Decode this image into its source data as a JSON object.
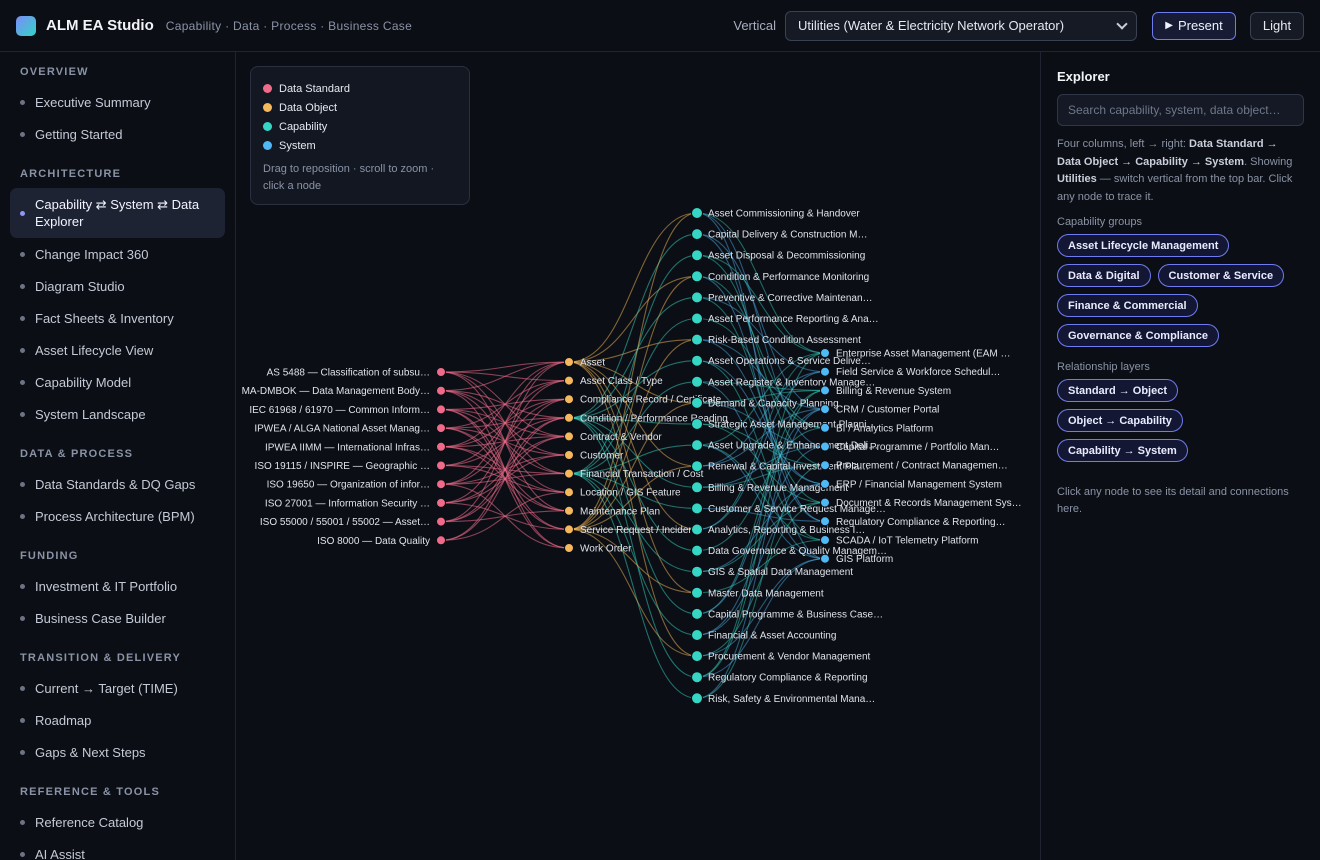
{
  "app": {
    "title": "ALM EA Studio",
    "subtitle": "Capability · Data · Process · Business Case",
    "vertical_label": "Vertical",
    "vertical_value": "Utilities (Water & Electricity Network Operator)",
    "present_label": "Present",
    "theme_label": "Light"
  },
  "sidebar": [
    {
      "section": "OVERVIEW",
      "items": [
        "Executive Summary",
        "Getting Started"
      ]
    },
    {
      "section": "ARCHITECTURE",
      "items": [
        "Capability ⇄ System ⇄ Data Explorer",
        "Change Impact 360",
        "Diagram Studio",
        "Fact Sheets & Inventory",
        "Asset Lifecycle View",
        "Capability Model",
        "System Landscape"
      ]
    },
    {
      "section": "DATA & PROCESS",
      "items": [
        "Data Standards & DQ Gaps",
        "Process Architecture (BPM)"
      ]
    },
    {
      "section": "FUNDING",
      "items": [
        "Investment & IT Portfolio",
        "Business Case Builder"
      ]
    },
    {
      "section": "TRANSITION & DELIVERY",
      "items": [
        "Current → Target (TIME)",
        "Roadmap",
        "Gaps & Next Steps"
      ]
    },
    {
      "section": "REFERENCE & TOOLS",
      "items": [
        "Reference Catalog",
        "AI Assist"
      ]
    }
  ],
  "active_nav": "Capability ⇄ System ⇄ Data Explorer",
  "legend": {
    "items": [
      {
        "label": "Data Standard",
        "color": "#f06b8a"
      },
      {
        "label": "Data Object",
        "color": "#f5b95c"
      },
      {
        "label": "Capability",
        "color": "#35d6c4"
      },
      {
        "label": "System",
        "color": "#4fb9f5"
      }
    ],
    "hint": "Drag to reposition · scroll to zoom · click a node"
  },
  "graph": {
    "standards": [
      "AS 5488 — Classification of subsu…",
      "MA-DMBOK — Data Management Body…",
      "IEC 61968 / 61970 — Common Inform…",
      "IPWEA / ALGA National Asset Manag…",
      "IPWEA IIMM — International Infras…",
      "ISO 19115 / INSPIRE — Geographic …",
      "ISO 19650 — Organization of infor…",
      "ISO 27001 — Information Security …",
      "ISO 55000 / 55001 / 55002 — Asset…",
      "ISO 8000 — Data Quality"
    ],
    "objects": [
      "Asset",
      "Asset Class / Type",
      "Compliance Record / Certificate",
      "Condition / Performance Reading",
      "Contract & Vendor",
      "Customer",
      "Financial Transaction / Cost",
      "Location / GIS Feature",
      "Maintenance Plan",
      "Service Request / Incident",
      "Work Order"
    ],
    "capabilities": [
      "Asset Commissioning & Handover",
      "Capital Delivery & Construction M…",
      "Asset Disposal & Decommissioning",
      "Condition & Performance Monitoring",
      "Preventive & Corrective Maintenan…",
      "Asset Performance Reporting & Ana…",
      "Risk-Based Condition Assessment",
      "Asset Operations & Service Delive…",
      "Asset Register & Inventory Manage…",
      "Demand & Capacity Planning",
      "Strategic Asset Management Planni…",
      "Asset Upgrade & Enhancement Deli…",
      "Renewal & Capital Investment Pla…",
      "Billing & Revenue Management",
      "Customer & Service Request Manage…",
      "Analytics, Reporting & Business I…",
      "Data Governance & Quality Managem…",
      "GIS & Spatial Data Management",
      "Master Data Management",
      "Capital Programme & Business Case…",
      "Financial & Asset Accounting",
      "Procurement & Vendor Management",
      "Regulatory Compliance & Reporting",
      "Risk, Safety & Environmental Mana…"
    ],
    "systems": [
      "Enterprise Asset Management (EAM …",
      "Field Service & Workforce Schedul…",
      "Billing & Revenue System",
      "CRM / Customer Portal",
      "BI / Analytics Platform",
      "Capital Programme / Portfolio Man…",
      "Procurement / Contract Managemen…",
      "ERP / Financial Management System",
      "Document & Records Management Sys…",
      "Regulatory Compliance & Reporting…",
      "SCADA / IoT Telemetry Platform",
      "GIS Platform"
    ]
  },
  "explorer": {
    "title": "Explorer",
    "search_placeholder": "Search capability, system, data object…",
    "desc_1": "Four columns, left → right: ",
    "desc_flow": "Data Standard → Data Object → Capability → System",
    "desc_2": ". Showing ",
    "desc_vertical": "Utilities",
    "desc_3": " — switch vertical from the top bar. Click any node to trace it.",
    "groups_label": "Capability groups",
    "groups": [
      "Asset Lifecycle Management",
      "Data & Digital",
      "Customer & Service",
      "Finance & Commercial",
      "Governance & Compliance"
    ],
    "layers_label": "Relationship layers",
    "layers": [
      "Standard → Object",
      "Object → Capability",
      "Capability → System"
    ],
    "hint": "Click any node to see its detail and connections here."
  }
}
